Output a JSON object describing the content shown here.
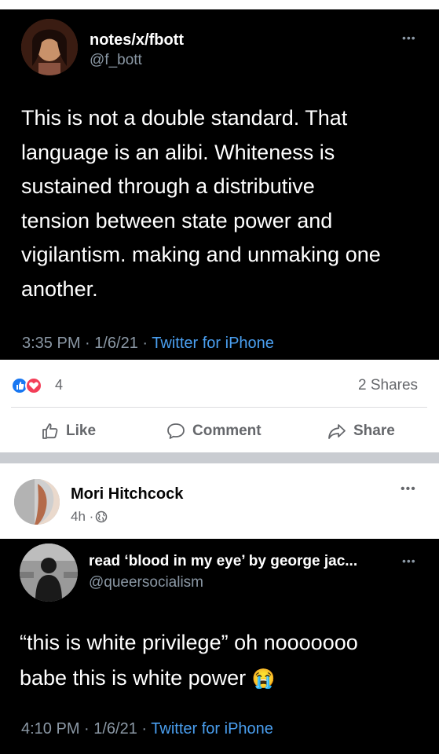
{
  "tweet1": {
    "name": "notes/x/fbott",
    "handle": "@f_bott",
    "text_lines": [
      "This is not a double standard. That",
      "language is an alibi. Whiteness is",
      "sustained through a distributive",
      "tension between state power and",
      "vigilantism. making and unmaking one",
      "another."
    ],
    "time": "3:35 PM · 1/6/21 · ",
    "source": "Twitter for iPhone"
  },
  "facebook": {
    "reaction_count": "4",
    "shares": "2 Shares",
    "actions": {
      "like": "Like",
      "comment": "Comment",
      "share": "Share"
    }
  },
  "post2": {
    "author": "Mori Hitchcock",
    "time": "4h · "
  },
  "tweet2": {
    "name": "read ‘blood in my eye’ by george jac...",
    "handle": "@queersocialism",
    "text_line1": "“this is white privilege” oh nooooooo",
    "text_line2": "babe this is white power ",
    "emoji": "😭",
    "time": "4:10 PM · 1/6/21 · ",
    "source": "Twitter for iPhone"
  },
  "colors": {
    "facebook_like": "#1877f2",
    "facebook_love": "#f33e58",
    "twitter_link": "#4a9ff0"
  }
}
